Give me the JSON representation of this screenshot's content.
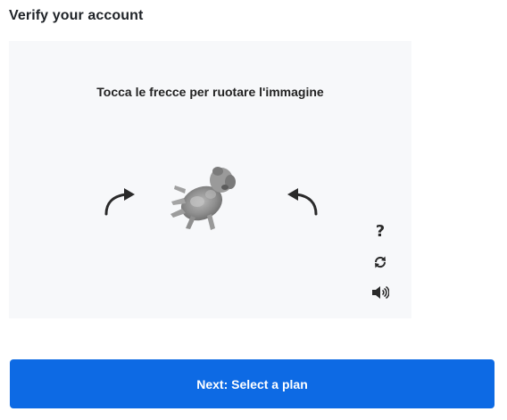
{
  "page": {
    "title": "Verify your account"
  },
  "captcha": {
    "instruction": "Tocca le frecce per ruotare l'immagine",
    "help_symbol": "?",
    "icons": {
      "rotate_left": "rotate-left-arrow-icon",
      "rotate_right": "rotate-right-arrow-icon",
      "help": "question-mark-icon",
      "refresh": "refresh-icon",
      "audio": "speaker-icon"
    }
  },
  "footer": {
    "next_label": "Next: Select a plan"
  },
  "colors": {
    "primary": "#0d6ae4",
    "panel_background": "#f7f8fa",
    "text": "#1f2328"
  }
}
